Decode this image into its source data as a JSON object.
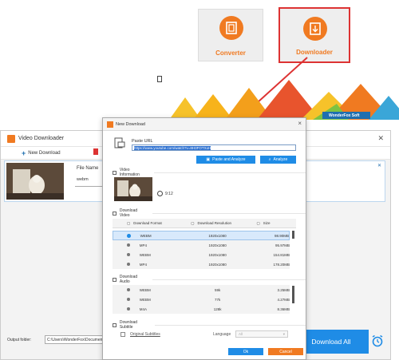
{
  "launcher": {
    "converter_label": "Converter",
    "downloader_label": "Downloader",
    "brand": "WonderFox Soft"
  },
  "video_downloader": {
    "title": "Video Downloader",
    "new_download": "New Download",
    "file_name_label": "File Name",
    "format_value": "webm",
    "output_folder_label": "Output folder:",
    "output_folder_value": "C:\\Users\\WonderFox\\Documents\\",
    "download_all": "Download All"
  },
  "new_download": {
    "title": "New Download",
    "paste_url_label": "Paste URL",
    "url_value": "https://www.youtube.com/watch?v=8H3FOTXoH",
    "paste_and_analyze": "Paste and Analyze",
    "analyze": "Analyze",
    "video_information": "Video Information",
    "duration": "9:12",
    "download_video": "Download Video",
    "headers": {
      "format": "Download Format",
      "resolution": "Download Resolution",
      "size": "Size"
    },
    "video_rows": [
      {
        "format": "WEBM",
        "resolution": "1920x1080",
        "size": "98.90MB",
        "selected": true
      },
      {
        "format": "MP4",
        "resolution": "1920x1080",
        "size": "95.97MB",
        "selected": false
      },
      {
        "format": "WEBM",
        "resolution": "1920x1080",
        "size": "154.81MB",
        "selected": false
      },
      {
        "format": "MP4",
        "resolution": "1920x1080",
        "size": "178.20MB",
        "selected": false
      }
    ],
    "download_audio": "Download Audio",
    "audio_rows": [
      {
        "format": "WEBM",
        "bitrate": "59k",
        "size": "3.25MB"
      },
      {
        "format": "WEBM",
        "bitrate": "77k",
        "size": "4.27MB"
      },
      {
        "format": "M4A",
        "bitrate": "128k",
        "size": "8.36MB"
      }
    ],
    "download_subtitle": "Download Subtitle",
    "original_subtitles": "Original Subtitles",
    "language_label": "Language",
    "language_value": "All",
    "ok": "Ok",
    "cancel": "Cancel"
  },
  "colors": {
    "accent_orange": "#f07a21",
    "accent_blue": "#1f8ce6",
    "highlight_red": "#d33333"
  }
}
